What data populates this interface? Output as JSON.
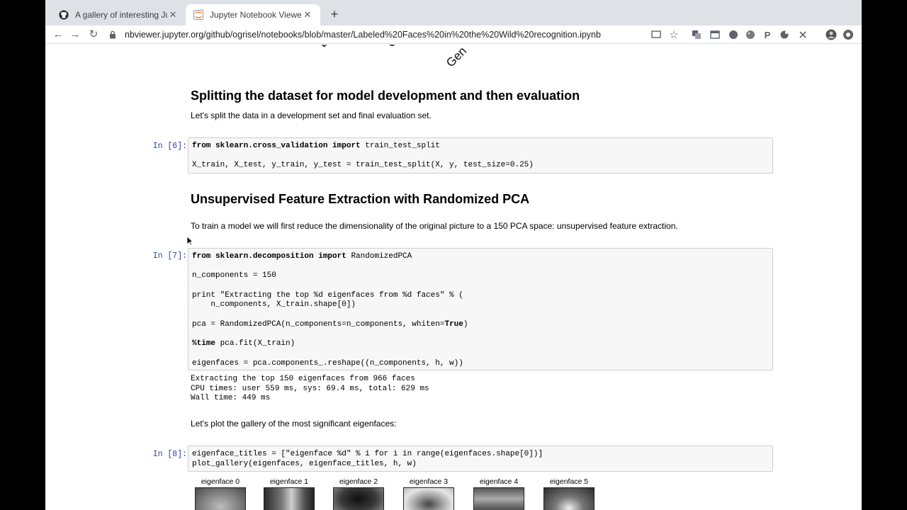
{
  "tabs": [
    {
      "title": "A gallery of interesting Jupyte",
      "icon": "github-icon",
      "active": false
    },
    {
      "title": "Jupyter Notebook Viewer",
      "icon": "jupyter-icon",
      "active": true
    }
  ],
  "toolbar": {
    "back_icon": "←",
    "forward_icon": "→",
    "reload_icon": "↻",
    "url": "nbviewer.jupyter.org/github/ogrisel/notebooks/blob/master/Labeled%20Faces%20in%20the%20Wild%20recognition.ipynb",
    "star_icon": "☆",
    "more_icon": "⋮"
  },
  "top_fragments": {
    "a": "Do",
    "b": "G",
    "c": "Gen"
  },
  "sections": {
    "split": {
      "heading": "Splitting the dataset for model development and then evaluation",
      "text": "Let's split the data in a development set and final evaluation set."
    },
    "pca": {
      "heading": "Unsupervised Feature Extraction with Randomized PCA",
      "text": "To train a model we will first reduce the dimensionality of the original picture to a 150 PCA space: unsupervised feature extraction."
    },
    "gallery_text": "Let's plot the gallery of the most significant eigenfaces:"
  },
  "cells": {
    "c6": {
      "prompt": "In [6]:",
      "l1_kw1": "from",
      "l1_mod": " sklearn.cross_validation ",
      "l1_kw2": "import",
      "l1_rest": " train_test_split",
      "l2": "X_train, X_test, y_train, y_test = train_test_split(X, y, test_size=0.25)"
    },
    "c7": {
      "prompt": "In [7]:",
      "l1_kw1": "from",
      "l1_mod": " sklearn.decomposition ",
      "l1_kw2": "import",
      "l1_rest": " RandomizedPCA",
      "l2": "n_components = 150",
      "l3": "print \"Extracting the top %d eigenfaces from %d faces\" % (",
      "l4": "    n_components, X_train.shape[0])",
      "l5a": "pca = RandomizedPCA(n_components=n_components, whiten=",
      "l5kw": "True",
      "l5b": ")",
      "l6kw": "%time",
      "l6": " pca.fit(X_train)",
      "l7": "eigenfaces = pca.components_.reshape((n_components, h, w))",
      "out1": "Extracting the top 150 eigenfaces from 966 faces",
      "out2": "CPU times: user 559 ms, sys: 69.4 ms, total: 629 ms",
      "out3": "Wall time: 449 ms"
    },
    "c8": {
      "prompt": "In [8]:",
      "l1": "eigenface_titles = [\"eigenface %d\" % i for i in range(eigenfaces.shape[0])]",
      "l2": "plot_gallery(eigenfaces, eigenface_titles, h, w)"
    }
  },
  "gallery": [
    "eigenface 0",
    "eigenface 1",
    "eigenface 2",
    "eigenface 3",
    "eigenface 4",
    "eigenface 5"
  ]
}
